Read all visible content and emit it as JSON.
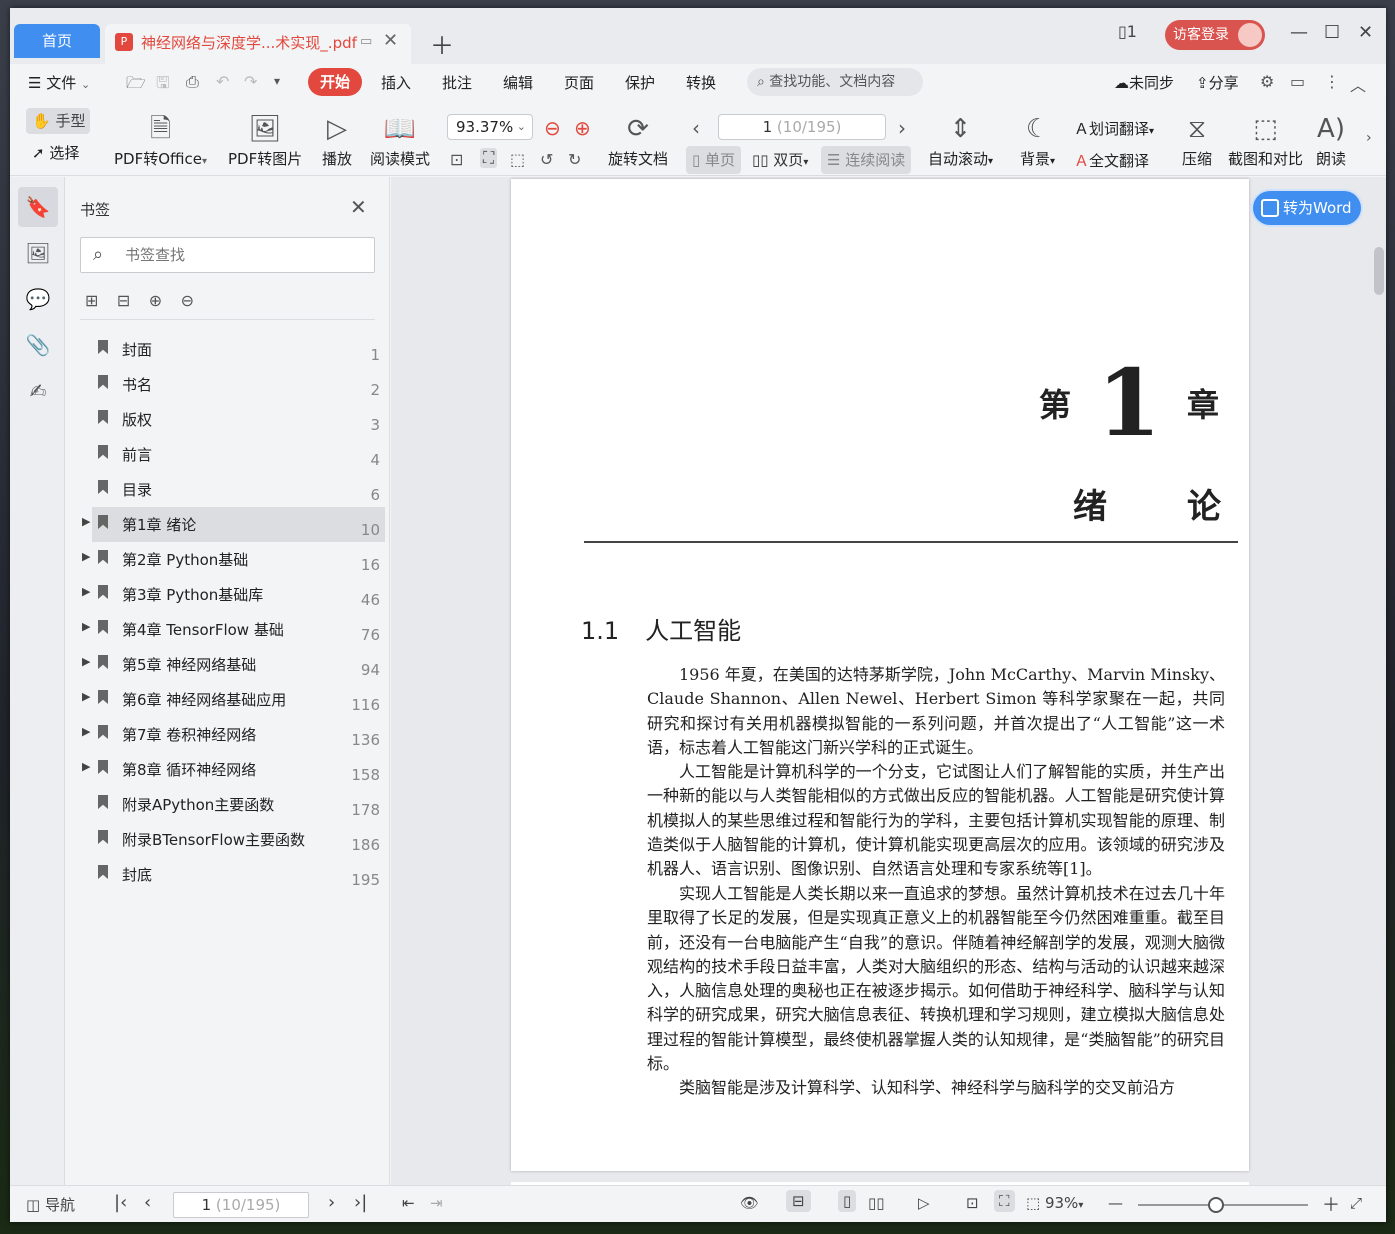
{
  "tabs": {
    "home": "首页",
    "document": "神经网络与深度学...术实现_.pdf"
  },
  "titlebar": {
    "login": "访客登录"
  },
  "menu": {
    "file": "文件",
    "items": [
      "开始",
      "插入",
      "批注",
      "编辑",
      "页面",
      "保护",
      "转换"
    ],
    "search_placeholder": "查找功能、文档内容",
    "sync": "未同步",
    "share": "分享"
  },
  "toolbar": {
    "hand": "手型",
    "select": "选择",
    "pdf_to_office": "PDF转Office",
    "pdf_to_image": "PDF转图片",
    "play": "播放",
    "read_mode": "阅读模式",
    "zoom": "93.37%",
    "rotate": "旋转文档",
    "page_current": "1",
    "page_total": "(10/195)",
    "single": "单页",
    "double": "双页",
    "continuous": "连续阅读",
    "auto_scroll": "自动滚动",
    "background": "背景",
    "word_translate": "划词翻译",
    "full_translate": "全文翻译",
    "compress": "压缩",
    "screenshot_compare": "截图和对比",
    "read_aloud": "朗读"
  },
  "bookmarks": {
    "title": "书签",
    "search_placeholder": "书签查找",
    "items": [
      {
        "label": "封面",
        "page": "1",
        "expandable": false
      },
      {
        "label": "书名",
        "page": "2",
        "expandable": false
      },
      {
        "label": "版权",
        "page": "3",
        "expandable": false
      },
      {
        "label": "前言",
        "page": "4",
        "expandable": false
      },
      {
        "label": "目录",
        "page": "6",
        "expandable": false
      },
      {
        "label": "第1章 绪论",
        "page": "10",
        "expandable": true,
        "active": true
      },
      {
        "label": "第2章 Python基础",
        "page": "16",
        "expandable": true
      },
      {
        "label": "第3章 Python基础库",
        "page": "46",
        "expandable": true
      },
      {
        "label": "第4章 TensorFlow 基础",
        "page": "76",
        "expandable": true
      },
      {
        "label": "第5章 神经网络基础",
        "page": "94",
        "expandable": true
      },
      {
        "label": "第6章 神经网络基础应用",
        "page": "116",
        "expandable": true
      },
      {
        "label": "第7章 卷积神经网络",
        "page": "136",
        "expandable": true
      },
      {
        "label": "第8章 循环神经网络",
        "page": "158",
        "expandable": true
      },
      {
        "label": "附录APython主要函数",
        "page": "178",
        "expandable": false
      },
      {
        "label": "附录BTensorFlow主要函数",
        "page": "186",
        "expandable": false
      },
      {
        "label": "封底",
        "page": "195",
        "expandable": false
      }
    ]
  },
  "document": {
    "to_word": "转为Word",
    "chapter_prefix": "第",
    "chapter_number": "1",
    "chapter_suffix": "章",
    "chapter_title": "绪论",
    "section_number": "1.1",
    "section_title": "人工智能",
    "paragraphs": [
      "1956 年夏，在美国的达特茅斯学院，John McCarthy、Marvin Minsky、Claude Shannon、Allen Newel、Herbert Simon 等科学家聚在一起，共同研究和探讨有关用机器模拟智能的一系列问题，并首次提出了“人工智能”这一术语，标志着人工智能这门新兴学科的正式诞生。",
      "人工智能是计算机科学的一个分支，它试图让人们了解智能的实质，并生产出一种新的能以与人类智能相似的方式做出反应的智能机器。人工智能是研究使计算机模拟人的某些思维过程和智能行为的学科，主要包括计算机实现智能的原理、制造类似于人脑智能的计算机，使计算机能实现更高层次的应用。该领域的研究涉及机器人、语言识别、图像识别、自然语言处理和专家系统等[1]。",
      "实现人工智能是人类长期以来一直追求的梦想。虽然计算机技术在过去几十年里取得了长足的发展，但是实现真正意义上的机器智能至今仍然困难重重。截至目前，还没有一台电脑能产生“自我”的意识。伴随着神经解剖学的发展，观测大脑微观结构的技术手段日益丰富，人类对大脑组织的形态、结构与活动的认识越来越深入，人脑信息处理的奥秘也正在被逐步揭示。如何借助于神经科学、脑科学与认知科学的研究成果，研究大脑信息表征、转换机理和学习规则，建立模拟大脑信息处理过程的智能计算模型，最终使机器掌握人类的认知规律，是“类脑智能”的研究目标。",
      "类脑智能是涉及计算科学、认知科学、神经科学与脑科学的交叉前沿方"
    ]
  },
  "statusbar": {
    "nav": "导航",
    "page_current": "1",
    "page_total": "(10/195)",
    "zoom": "93%"
  }
}
